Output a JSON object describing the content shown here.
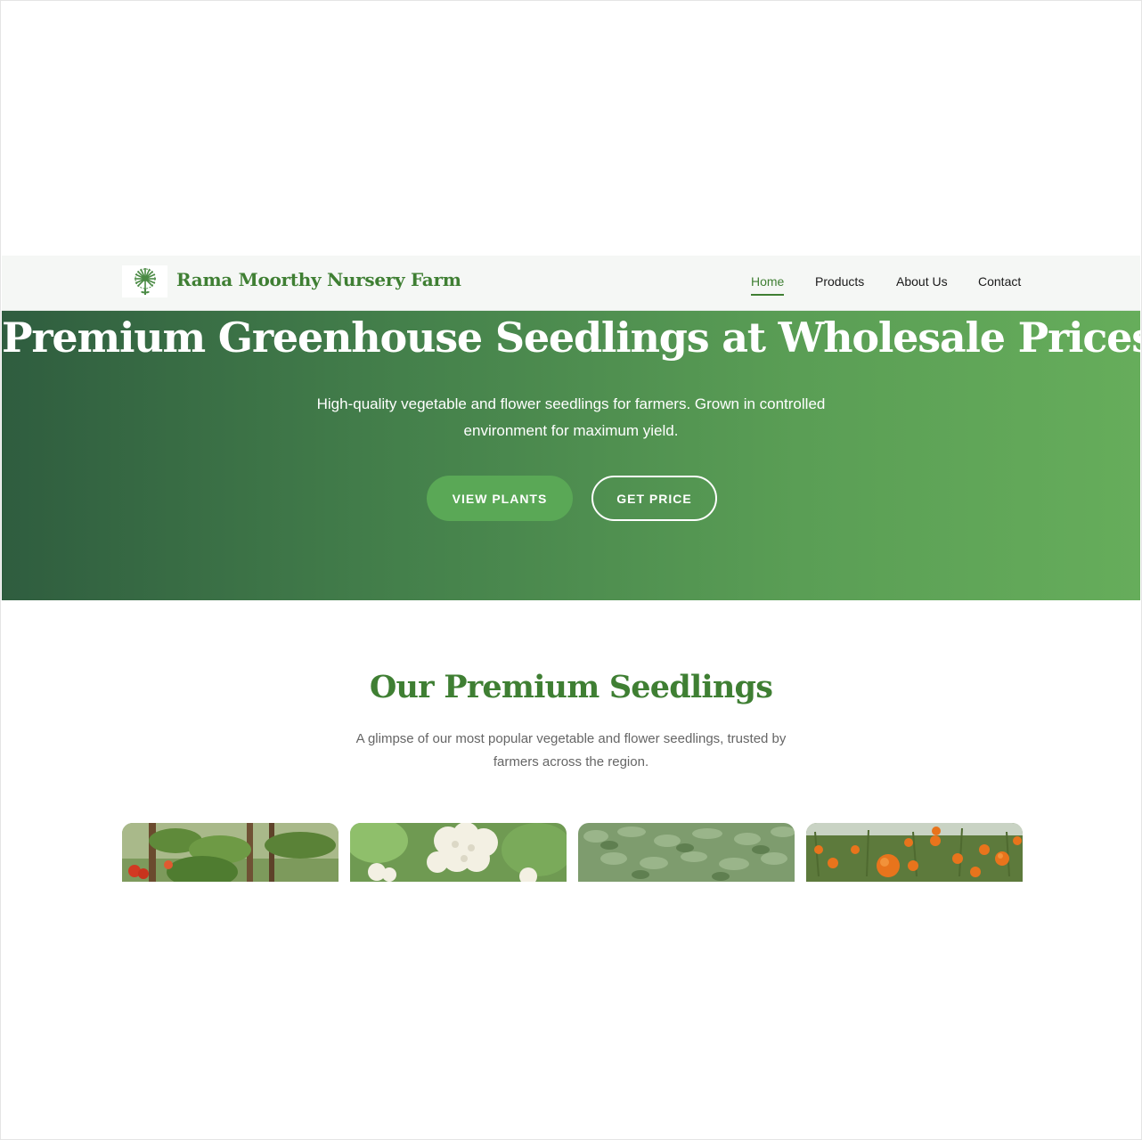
{
  "brand": {
    "name": "Rama Moorthy Nursery Farm",
    "logo_icon": "sunflower-tree-logo-icon"
  },
  "nav": {
    "items": [
      {
        "label": "Home",
        "active": true
      },
      {
        "label": "Products",
        "active": false
      },
      {
        "label": "About Us",
        "active": false
      },
      {
        "label": "Contact",
        "active": false
      }
    ]
  },
  "hero": {
    "title": "Premium Greenhouse Seedlings at Wholesale Prices",
    "subtitle": "High-quality vegetable and flower seedlings for farmers. Grown in controlled environment for maximum yield.",
    "primary_button": "VIEW PLANTS",
    "secondary_button": "GET PRICE"
  },
  "products": {
    "title": "Our Premium Seedlings",
    "subtitle": "A glimpse of our most popular vegetable and flower seedlings, trusted by farmers across the region.",
    "cards": [
      {
        "image": "tomato-plants-photo"
      },
      {
        "image": "cauliflower-photo"
      },
      {
        "image": "leafy-seedlings-photo"
      },
      {
        "image": "marigold-flowers-photo"
      }
    ]
  },
  "colors": {
    "brand_green": "#3f7f33",
    "hero_gradient_start": "#2f5d3f",
    "hero_gradient_end": "#66ad5b",
    "button_green": "#5aa856"
  }
}
